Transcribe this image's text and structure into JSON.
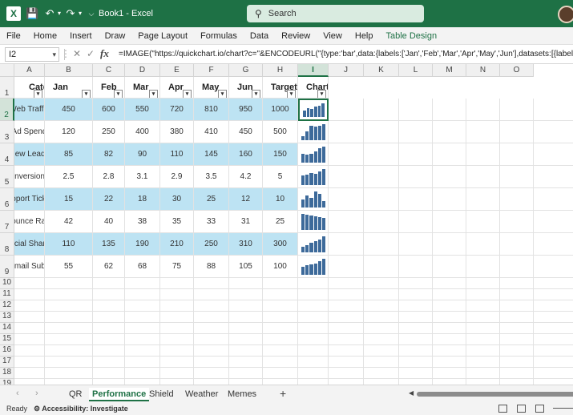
{
  "titlebar": {
    "filename": "Book1",
    "app": "Excel",
    "separator": " - ",
    "search_placeholder": "Search",
    "icons": [
      "excel-logo-icon",
      "save-icon",
      "undo-icon",
      "redo-icon",
      "customize-icon",
      "search-icon",
      "avatar"
    ]
  },
  "menu": [
    "File",
    "Home",
    "Insert",
    "Draw",
    "Page Layout",
    "Formulas",
    "Data",
    "Review",
    "View",
    "Help",
    "Table Design"
  ],
  "formula_bar": {
    "name_box": "I2",
    "formula": "=IMAGE(\"https://quickchart.io/chart?c=\"&ENCODEURL(\"{type:'bar',data:{labels:['Jan','Feb','Mar','Apr','May','Jun'],datasets:[{label:'\"&A2&\"',"
  },
  "columns": [
    "A",
    "B",
    "C",
    "D",
    "E",
    "F",
    "G",
    "H",
    "I",
    "J",
    "K",
    "L",
    "M",
    "N",
    "O"
  ],
  "table": {
    "headers": [
      "Category",
      "Jan",
      "Feb",
      "Mar",
      "Apr",
      "May",
      "Jun",
      "Target",
      "Chart"
    ],
    "rows": [
      {
        "category": "Web Traffic",
        "values": [
          "450",
          "600",
          "550",
          "720",
          "810",
          "950",
          "1000"
        ],
        "spark": [
          450,
          600,
          550,
          720,
          810,
          950
        ]
      },
      {
        "category": "Ad Spend",
        "values": [
          "120",
          "250",
          "400",
          "380",
          "410",
          "450",
          "500"
        ],
        "spark": [
          120,
          250,
          400,
          380,
          410,
          450
        ]
      },
      {
        "category": "New Leads",
        "values": [
          "85",
          "82",
          "90",
          "110",
          "145",
          "160",
          "150"
        ],
        "spark": [
          85,
          82,
          90,
          110,
          145,
          160
        ]
      },
      {
        "category": "Conversion %",
        "values": [
          "2.5",
          "2.8",
          "3.1",
          "2.9",
          "3.5",
          "4.2",
          "5"
        ],
        "spark": [
          2.5,
          2.8,
          3.1,
          2.9,
          3.5,
          4.2
        ]
      },
      {
        "category": "Support Tickets",
        "values": [
          "15",
          "22",
          "18",
          "30",
          "25",
          "12",
          "10"
        ],
        "spark": [
          15,
          22,
          18,
          30,
          25,
          12
        ]
      },
      {
        "category": "Bounce Rate",
        "values": [
          "42",
          "40",
          "38",
          "35",
          "33",
          "31",
          "25"
        ],
        "spark": [
          42,
          40,
          38,
          35,
          33,
          31
        ]
      },
      {
        "category": "Social Shares",
        "values": [
          "110",
          "135",
          "190",
          "210",
          "250",
          "310",
          "300"
        ],
        "spark": [
          110,
          135,
          190,
          210,
          250,
          310
        ]
      },
      {
        "category": "Email Subs",
        "values": [
          "55",
          "62",
          "68",
          "75",
          "88",
          "105",
          "100"
        ],
        "spark": [
          55,
          62,
          68,
          75,
          88,
          105
        ]
      }
    ]
  },
  "empty_rows": [
    "10",
    "11",
    "12",
    "13",
    "14",
    "15",
    "16",
    "17",
    "18",
    "19"
  ],
  "sheets": {
    "tabs": [
      "QR",
      "Performance",
      "Shield",
      "Weather",
      "Memes"
    ],
    "active": "Performance",
    "add_label": "+"
  },
  "status": {
    "ready": "Ready",
    "accessibility": "Accessibility: Investigate"
  },
  "colors": {
    "brand": "#1e7145",
    "band": "#bde3f3",
    "spark": "#3d6a9a"
  }
}
